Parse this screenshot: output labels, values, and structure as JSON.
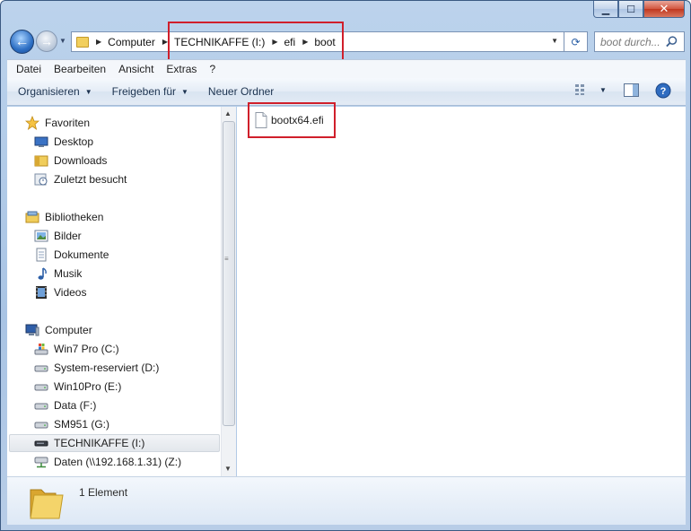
{
  "window": {
    "minimize": "▁",
    "maximize": "☐",
    "close": "✕"
  },
  "navigation": {
    "breadcrumbs": [
      "Computer",
      "TECHNIKAFFE (I:)",
      "efi",
      "boot"
    ],
    "search_placeholder": "boot durch..."
  },
  "menu": [
    "Datei",
    "Bearbeiten",
    "Ansicht",
    "Extras",
    "?"
  ],
  "commands": {
    "organize": "Organisieren",
    "share": "Freigeben für",
    "new_folder": "Neuer Ordner"
  },
  "tree": {
    "favorites": {
      "label": "Favoriten",
      "items": [
        "Desktop",
        "Downloads",
        "Zuletzt besucht"
      ]
    },
    "libraries": {
      "label": "Bibliotheken",
      "items": [
        "Bilder",
        "Dokumente",
        "Musik",
        "Videos"
      ]
    },
    "computer": {
      "label": "Computer",
      "items": [
        "Win7 Pro (C:)",
        "System-reserviert (D:)",
        "Win10Pro (E:)",
        "Data (F:)",
        "SM951 (G:)",
        "TECHNIKAFFE (I:)",
        "Daten (\\\\192.168.1.31) (Z:)"
      ]
    }
  },
  "files": [
    "bootx64.efi"
  ],
  "details": {
    "count_text": "1 Element"
  },
  "colors": {
    "highlight": "#d01f2b",
    "accent": "#2d6fc4"
  }
}
